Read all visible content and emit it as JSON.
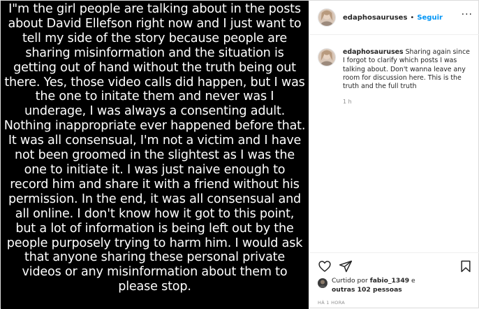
{
  "post": {
    "image_text": "I\"m the girl people are talking about in the posts about David Ellefson right now and I just want to tell my side of the story because people are sharing misinformation and the situation is getting out of hand without the truth being out there. Yes, those video calls did happen, but I was the one to initate them and never was I underage, I was always a consenting adult. Nothing inappropriate ever happened before that. It was all consensual, I'm not a victim and I have not been groomed in the slightest as I was the one to initiate it. I was just naive enough to record him and share it with a friend without his permission. In the end, it was all consensual and all online. I don't know how it got to this point, but a lot of information is being left out by the people purposely trying to harm him. I would ask that anyone sharing these personal private videos or any misinformation about them to please stop."
  },
  "header": {
    "username": "edaphosauruses",
    "separator": "•",
    "follow_label": "Seguir",
    "more_label": "···"
  },
  "caption": {
    "username": "edaphosauruses",
    "text": "Sharing again since I forgot to clarify which posts I was talking about. Don't wanna leave any room for discussion here. This is the truth and the full truth",
    "time": "1 h"
  },
  "actions": {
    "icons": [
      "heart-icon",
      "share-icon",
      "bookmark-icon"
    ]
  },
  "likes": {
    "prefix": "Curtido por ",
    "user": "fabio_1349",
    "middle": " e ",
    "others": "outras 102 pessoas"
  },
  "timestamp": "HÁ 1 HORA"
}
